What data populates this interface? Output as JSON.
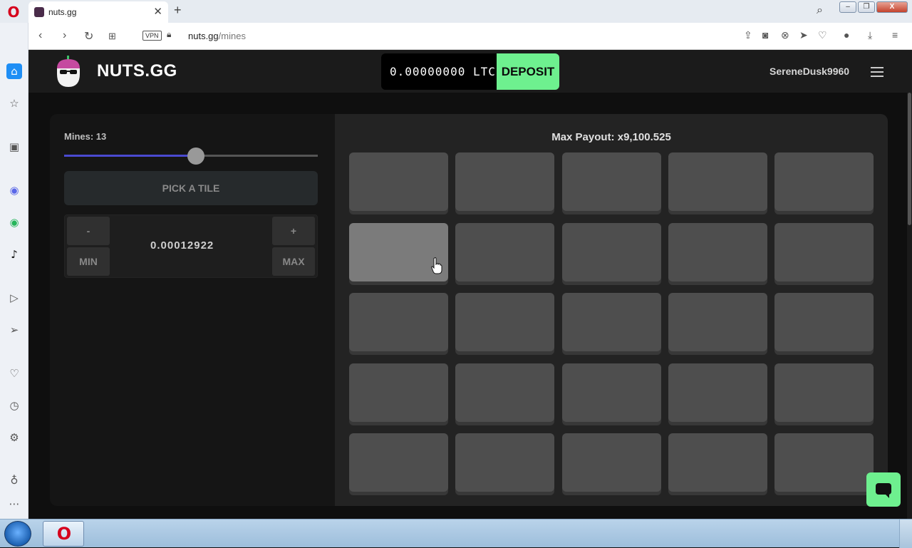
{
  "browser": {
    "tab_title": "nuts.gg",
    "tab_close": "✕",
    "new_tab": "+",
    "url_host": "nuts.gg",
    "url_path": "/mines",
    "vpn_label": "VPN"
  },
  "site": {
    "brand": "NUTS.GG",
    "balance": "0.00000000 LTC",
    "deposit_label": "DEPOSIT",
    "username": "SereneDusk9960"
  },
  "game": {
    "mines_label": "Mines: 13",
    "mines_count": 13,
    "slider_fraction": 0.52,
    "pick_tile_label": "PICK A TILE",
    "bet_minus": "-",
    "bet_plus": "+",
    "bet_min": "MIN",
    "bet_max": "MAX",
    "bet_value": "0.00012922",
    "max_payout": "Max Payout: x9,100.525",
    "grid_rows": 5,
    "grid_cols": 5,
    "hovered_tile_index": 5
  },
  "colors": {
    "accent_green": "#6ef08f",
    "slider_fill": "#4a4ad0"
  }
}
